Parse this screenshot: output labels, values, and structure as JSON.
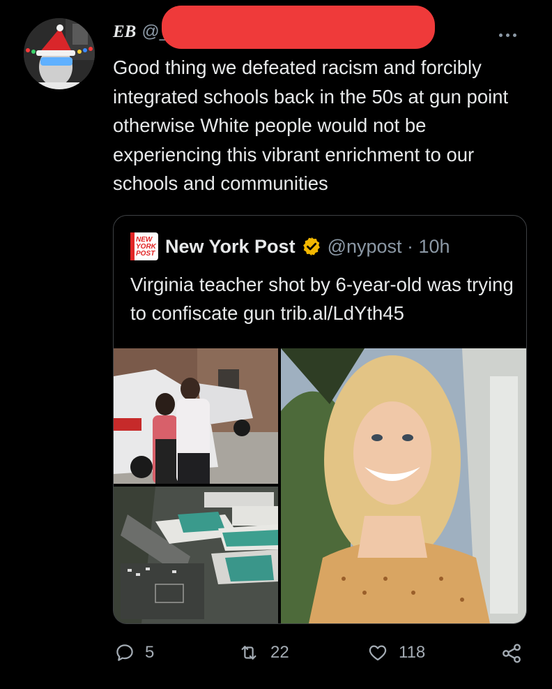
{
  "tweet": {
    "author_name": "EB",
    "author_handle": "@_",
    "text": "Good thing we defeated racism and forcibly integrated schools back in the 50s at gun point otherwise White people would not be experiencing this vibrant enrichment to our schools and communities",
    "more_icon": "more-horizontal-icon"
  },
  "quote": {
    "logo_text": [
      "NEW",
      "YORK",
      "POST"
    ],
    "name": "New York Post",
    "handle_time": "@nypost · 10h",
    "text": "Virginia teacher shot by 6-year-old was trying to confiscate gun trib.al/LdYth45",
    "verified_color": "#f2b701"
  },
  "actions": {
    "reply_count": "5",
    "retweet_count": "22",
    "like_count": "118"
  },
  "colors": {
    "background": "#000000",
    "text": "#e7e9ea",
    "muted": "#8b98a5",
    "redaction": "#ef3a3a",
    "nyp_red": "#e22626"
  }
}
